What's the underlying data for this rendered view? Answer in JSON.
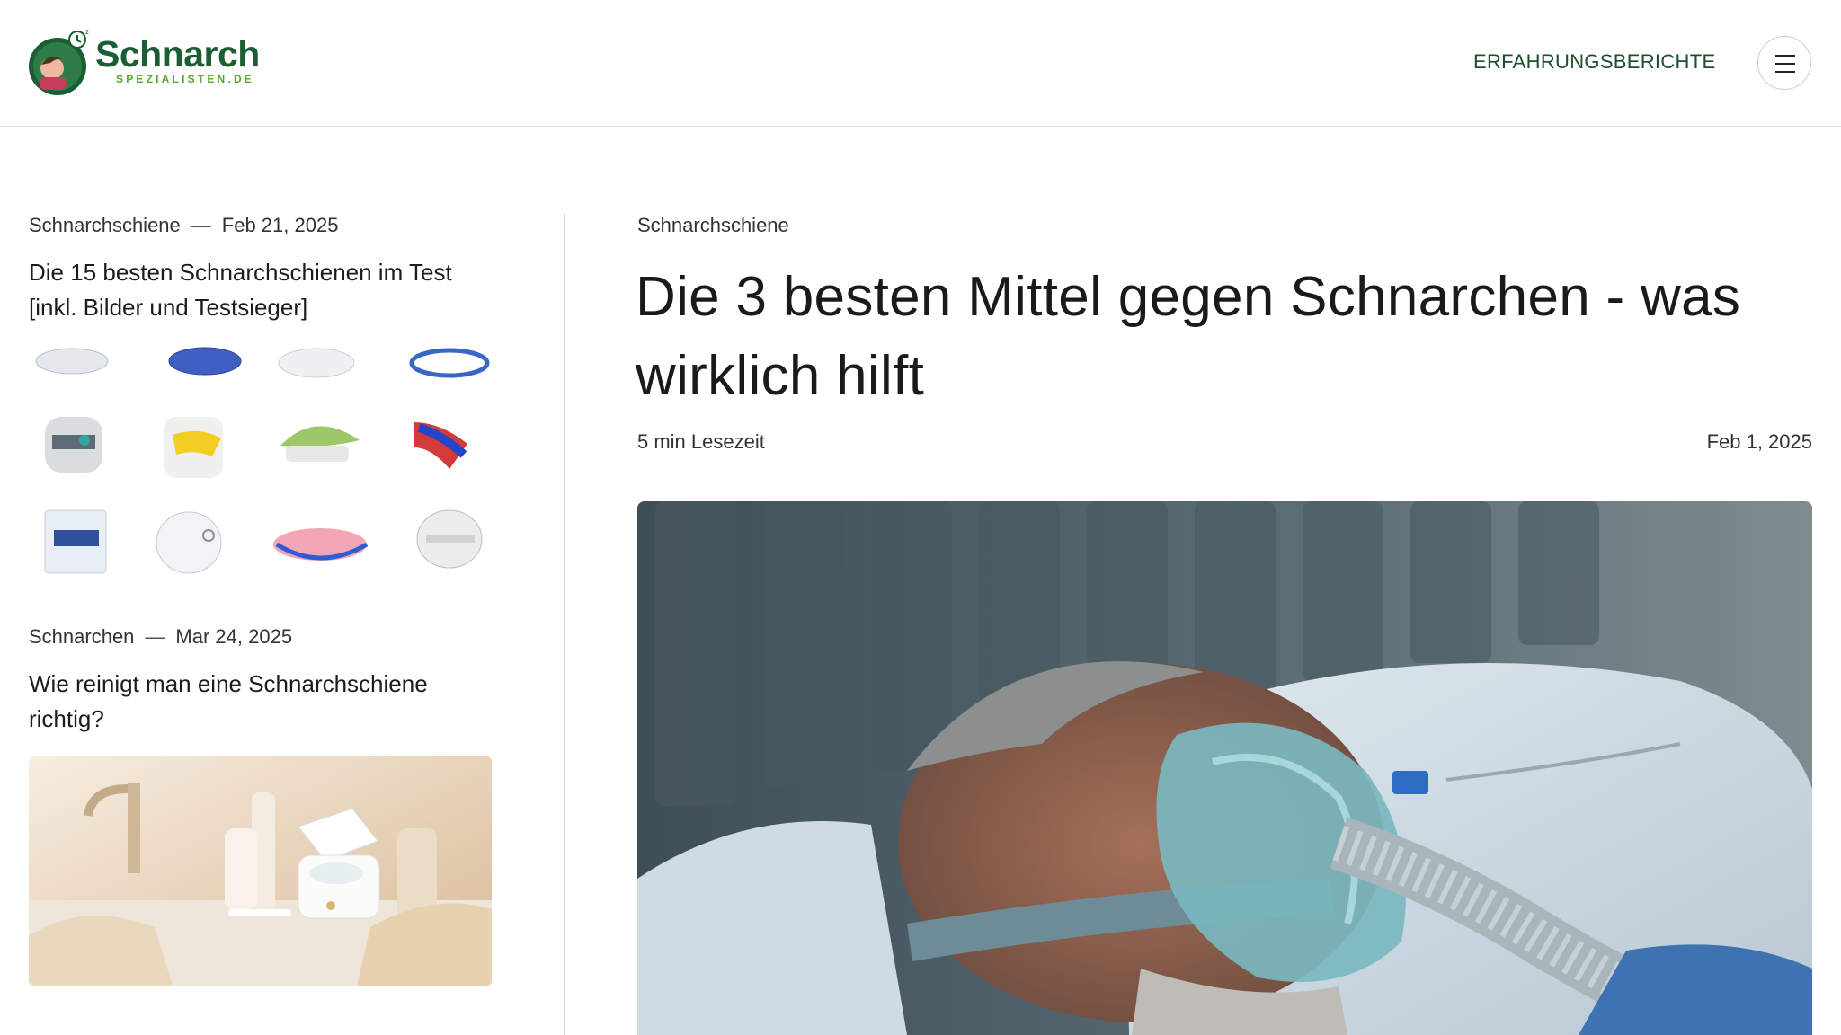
{
  "header": {
    "logo_title": "Schnarch",
    "logo_subtitle": "SPEZIALISTEN.DE",
    "nav_link": "ERFAHRUNGSBERICHTE",
    "menu_icon": "hamburger-menu-icon"
  },
  "sidebar": {
    "articles": [
      {
        "category": "Schnarchschiene",
        "separator": "—",
        "date": "Feb 21, 2025",
        "title": "Die 15 besten Schnarchschienen im Test [inkl. Bilder und Testsieger]"
      },
      {
        "category": "Schnarchen",
        "separator": "—",
        "date": "Mar 24, 2025",
        "title": "Wie reinigt man eine Schnarchschiene richtig?"
      }
    ]
  },
  "main": {
    "category": "Schnarchschiene",
    "title": "Die 3 besten Mittel gegen Schnarchen - was wirklich hilft",
    "read_time": "5 min Lesezeit",
    "date": "Feb 1, 2025"
  },
  "colors": {
    "brand_green": "#1b5e34",
    "brand_light_green": "#5aa52c",
    "nav_text": "#1b4d2e"
  }
}
